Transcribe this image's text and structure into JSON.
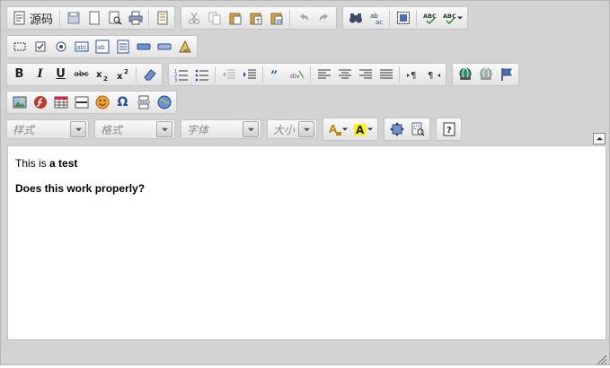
{
  "toolbar": {
    "source_label": "源码",
    "combos": {
      "style": "样式",
      "format": "格式",
      "font": "字体",
      "size": "大小"
    }
  },
  "colors": {
    "editor_bg": "#d3d3d3",
    "toolbar_group_bg": "#ececec",
    "content_bg": "#ffffff"
  },
  "content": {
    "line1_prefix": "This is ",
    "line1_bold": "a test",
    "line2_bold": "Does this work properly?"
  }
}
